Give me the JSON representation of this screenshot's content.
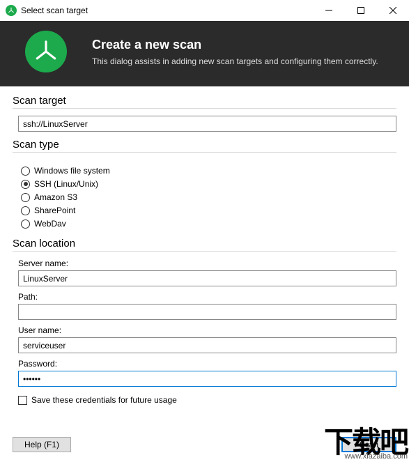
{
  "window": {
    "title": "Select scan target"
  },
  "header": {
    "title": "Create a new scan",
    "subtitle": "This dialog assists in adding new scan targets and configuring them correctly."
  },
  "scan_target": {
    "section": "Scan target",
    "value": "ssh://LinuxServer"
  },
  "scan_type": {
    "section": "Scan type",
    "options": [
      {
        "label": "Windows file system",
        "checked": false
      },
      {
        "label": "SSH (Linux/Unix)",
        "checked": true
      },
      {
        "label": "Amazon S3",
        "checked": false
      },
      {
        "label": "SharePoint",
        "checked": false
      },
      {
        "label": "WebDav",
        "checked": false
      }
    ]
  },
  "scan_location": {
    "section": "Scan location",
    "server_label": "Server name:",
    "server_value": "LinuxServer",
    "path_label": "Path:",
    "path_value": "",
    "user_label": "User name:",
    "user_value": "serviceuser",
    "password_label": "Password:",
    "password_value": "••••••",
    "save_creds_label": "Save these credentials for future usage",
    "save_creds_checked": false
  },
  "footer": {
    "help": "Help (F1)",
    "scan": "Scan"
  },
  "watermark": {
    "text": "下载吧",
    "url": "www.xiazaiba.com"
  }
}
